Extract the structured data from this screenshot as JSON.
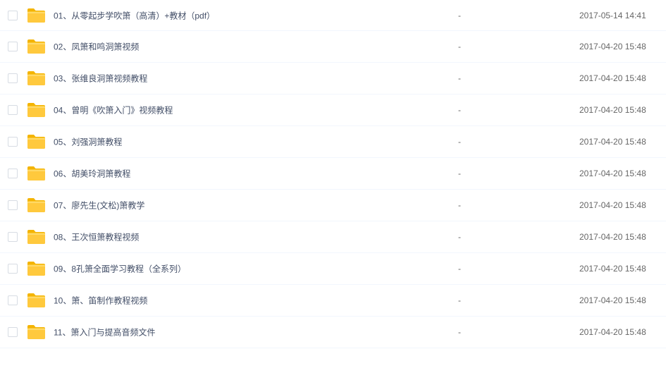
{
  "colors": {
    "folder": "#ffc93d",
    "folder_dark": "#f4b400",
    "row_divider": "#f2f6fd",
    "text": "#424e67"
  },
  "icons": {
    "folder": "folder-icon",
    "checkbox": "checkbox-icon"
  },
  "files": [
    {
      "name": "01、从零起步学吹箫（高清）+教材（pdf）",
      "size": "-",
      "date": "2017-05-14 14:41"
    },
    {
      "name": "02、凤箫和鸣洞箫视频",
      "size": "-",
      "date": "2017-04-20 15:48"
    },
    {
      "name": "03、张维良洞箫视频教程",
      "size": "-",
      "date": "2017-04-20 15:48"
    },
    {
      "name": "04、曾明《吹箫入门》视频教程",
      "size": "-",
      "date": "2017-04-20 15:48"
    },
    {
      "name": "05、刘强洞箫教程",
      "size": "-",
      "date": "2017-04-20 15:48"
    },
    {
      "name": "06、胡美玲洞箫教程",
      "size": "-",
      "date": "2017-04-20 15:48"
    },
    {
      "name": "07、廖先生(文松)箫教学",
      "size": "-",
      "date": "2017-04-20 15:48"
    },
    {
      "name": "08、王次恒箫教程视频",
      "size": "-",
      "date": "2017-04-20 15:48"
    },
    {
      "name": "09、8孔箫全面学习教程（全系列）",
      "size": "-",
      "date": "2017-04-20 15:48"
    },
    {
      "name": "10、箫、笛制作教程视频",
      "size": "-",
      "date": "2017-04-20 15:48"
    },
    {
      "name": "11、箫入门与提高音频文件",
      "size": "-",
      "date": "2017-04-20 15:48"
    }
  ]
}
